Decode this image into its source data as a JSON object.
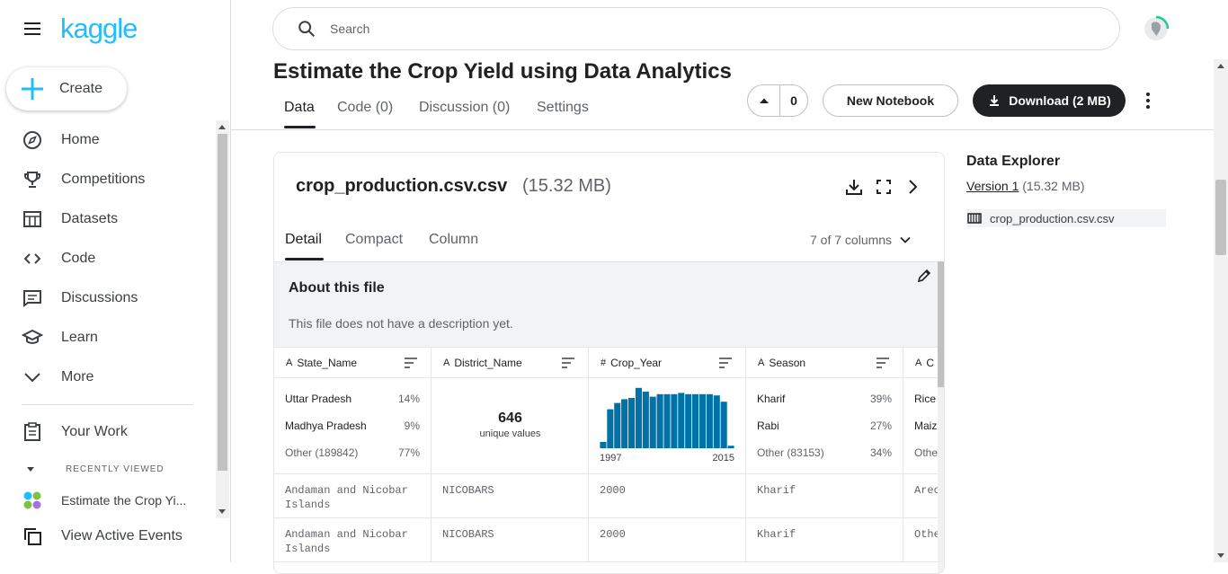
{
  "brand": {
    "logo_text": "kaggle"
  },
  "sidebar": {
    "create_label": "Create",
    "items": [
      {
        "label": "Home",
        "icon": "compass-icon"
      },
      {
        "label": "Competitions",
        "icon": "trophy-icon"
      },
      {
        "label": "Datasets",
        "icon": "table-icon"
      },
      {
        "label": "Code",
        "icon": "code-icon"
      },
      {
        "label": "Discussions",
        "icon": "comments-icon"
      },
      {
        "label": "Learn",
        "icon": "school-icon"
      },
      {
        "label": "More",
        "icon": "chevron-down-icon"
      }
    ],
    "your_work": "Your Work",
    "recently_viewed_heading": "RECENTLY VIEWED",
    "recent_item": "Estimate the Crop Yi...",
    "active_events": "View Active Events"
  },
  "search": {
    "placeholder": "Search"
  },
  "dataset": {
    "title": "Estimate the Crop Yield using Data Analytics",
    "tabs": [
      "Data",
      "Code (0)",
      "Discussion (0)",
      "Settings"
    ],
    "vote_count": "0",
    "new_notebook_label": "New Notebook",
    "download_label": "Download (2 MB)"
  },
  "file": {
    "name": "crop_production.csv.csv",
    "size": "(15.32 MB)",
    "view_tabs": [
      "Detail",
      "Compact",
      "Column"
    ],
    "column_count": "7 of 7 columns",
    "about_title": "About this file",
    "about_desc": "This file does not have a description yet."
  },
  "table": {
    "columns": [
      {
        "type_glyph": "A",
        "name": "State_Name"
      },
      {
        "type_glyph": "A",
        "name": "District_Name"
      },
      {
        "type_glyph": "#",
        "name": "Crop_Year"
      },
      {
        "type_glyph": "A",
        "name": "Season"
      },
      {
        "type_glyph": "A",
        "name": "C"
      }
    ],
    "state_summary": [
      {
        "label": "Uttar Pradesh",
        "pct": "14%"
      },
      {
        "label": "Madhya Pradesh",
        "pct": "9%"
      },
      {
        "label": "Other (189842)",
        "pct": "77%"
      }
    ],
    "district_unique": {
      "count": "646",
      "label": "unique values"
    },
    "crop_year_hist": {
      "min_label": "1997",
      "max_label": "2015"
    },
    "season_summary": [
      {
        "label": "Kharif",
        "pct": "39%"
      },
      {
        "label": "Rabi",
        "pct": "27%"
      },
      {
        "label": "Other (83153)",
        "pct": "34%"
      }
    ],
    "crop_summary_partial": [
      "Rice",
      "Maiz",
      "Othe"
    ],
    "rows": [
      [
        "Andaman and Nicobar Islands",
        "NICOBARS",
        "2000",
        "Kharif",
        "Arec"
      ],
      [
        "Andaman and Nicobar Islands",
        "NICOBARS",
        "2000",
        "Kharif",
        "Othe"
      ]
    ]
  },
  "chart_data": {
    "type": "bar",
    "title": "",
    "xlabel": "Crop_Year",
    "ylabel": "",
    "categories": [
      "1997",
      "1998",
      "1999",
      "2000",
      "2001",
      "2002",
      "2003",
      "2004",
      "2005",
      "2006",
      "2007",
      "2008",
      "2009",
      "2010",
      "2011",
      "2012",
      "2013",
      "2014",
      "2015"
    ],
    "values": [
      0.1,
      0.62,
      0.72,
      0.78,
      0.8,
      0.96,
      0.9,
      0.82,
      0.86,
      0.86,
      0.86,
      0.88,
      0.86,
      0.86,
      0.86,
      0.86,
      0.84,
      0.74,
      0.04
    ],
    "ylim": [
      0,
      1
    ],
    "color": "#0072a8"
  },
  "explorer": {
    "title": "Data Explorer",
    "version_link": "Version 1",
    "version_size": "(15.32 MB)",
    "file_label": "crop_production.csv.csv"
  },
  "colors": {
    "accent": "#20beff",
    "dark_button": "#202124",
    "hist_bar": "#0072a8"
  }
}
